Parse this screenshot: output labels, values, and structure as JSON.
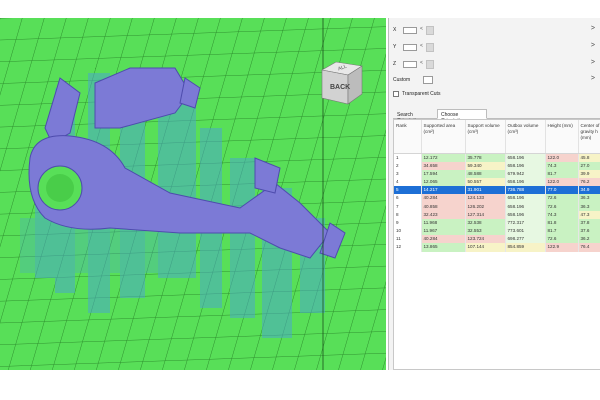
{
  "viewcube": {
    "face_label": "BACK",
    "top_label": "ALL",
    "icon": "view-cube-icon"
  },
  "panel": {
    "coords": [
      {
        "label": "X",
        "separator": "<"
      },
      {
        "label": "Y",
        "separator": "<"
      },
      {
        "label": "Z",
        "separator": "<"
      }
    ],
    "custom_label": "Custom",
    "custom_separator": "<",
    "chevron": ">",
    "transparent_cuts_label": "Transparent Cuts",
    "tabs": [
      {
        "label": "Search Orientations"
      },
      {
        "label": "Choose Orientation"
      }
    ]
  },
  "table": {
    "headers": [
      "Rank",
      "Supported area (cm²)",
      "Support volume (cm³)",
      "Outbox volume (cm³)",
      "Height (mm)",
      "Center of gravity h (mm)"
    ],
    "rows": [
      {
        "rank": "1",
        "area": "12.172",
        "support": "35.778",
        "outbox": "658.196",
        "height": "122.0",
        "cog": "45.8"
      },
      {
        "rank": "2",
        "area": "34.658",
        "support": "59.340",
        "outbox": "658.196",
        "height": "74.3",
        "cog": "27.0"
      },
      {
        "rank": "3",
        "area": "17.594",
        "support": "48.588",
        "outbox": "679.942",
        "height": "81.7",
        "cog": "39.9"
      },
      {
        "rank": "4",
        "area": "12.065",
        "support": "50.557",
        "outbox": "658.196",
        "height": "122.0",
        "cog": "76.2"
      },
      {
        "rank": "5",
        "area": "14.217",
        "support": "31.901",
        "outbox": "736.788",
        "height": "77.0",
        "cog": "34.9"
      },
      {
        "rank": "6",
        "area": "40.284",
        "support": "124.133",
        "outbox": "658.196",
        "height": "72.6",
        "cog": "36.3"
      },
      {
        "rank": "7",
        "area": "40.858",
        "support": "126.202",
        "outbox": "658.196",
        "height": "72.6",
        "cog": "36.3"
      },
      {
        "rank": "8",
        "area": "32.423",
        "support": "127.314",
        "outbox": "658.196",
        "height": "74.3",
        "cog": "47.3"
      },
      {
        "rank": "9",
        "area": "11.968",
        "support": "32.538",
        "outbox": "772.317",
        "height": "81.8",
        "cog": "37.8"
      },
      {
        "rank": "10",
        "area": "11.967",
        "support": "32.553",
        "outbox": "773.601",
        "height": "81.7",
        "cog": "37.6"
      },
      {
        "rank": "11",
        "area": "40.284",
        "support": "123.724",
        "outbox": "698.277",
        "height": "72.6",
        "cog": "36.2"
      },
      {
        "rank": "12",
        "area": "13.865",
        "support": "107.144",
        "outbox": "854.859",
        "height": "122.9",
        "cog": "76.4"
      }
    ],
    "selected_rank": "5",
    "cell_colors": {
      "green": "#c9f2c2",
      "pale": "#e7f8e2",
      "yellow": "#f7f3c7",
      "pink": "#f6d3cd",
      "selected": "#1d6fd6"
    }
  },
  "colors": {
    "build_plate": "#58df58",
    "part": "#7c7ad6",
    "supports": "#4aa9c9"
  }
}
